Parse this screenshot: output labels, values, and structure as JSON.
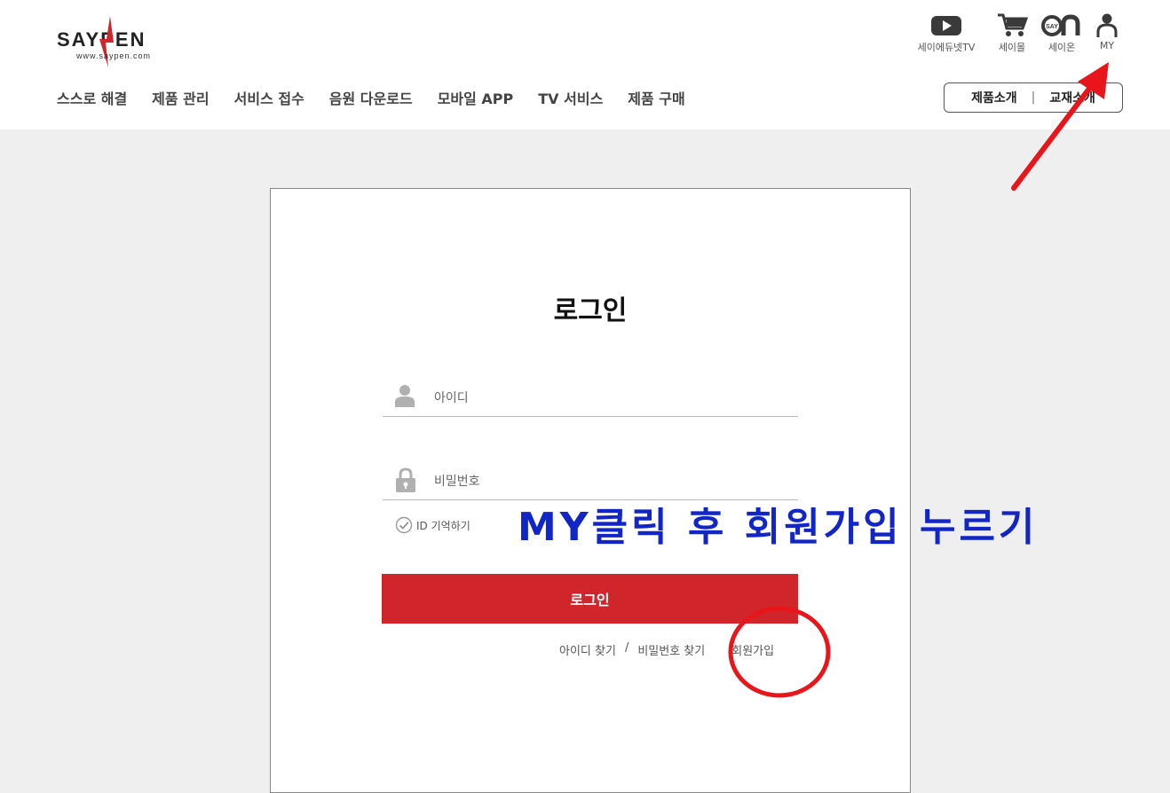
{
  "header": {
    "logo": {
      "text": "SAYPEN",
      "url": "www.saypen.com"
    },
    "nav": [
      "스스로 해결",
      "제품 관리",
      "서비스 접수",
      "음원 다운로드",
      "모바일 APP",
      "TV 서비스",
      "제품 구매"
    ],
    "utilities": [
      {
        "label": "세이에듀넷TV",
        "icon": "youtube-play-icon"
      },
      {
        "label": "세이몰",
        "icon": "shopping-cart-icon"
      },
      {
        "label": "세이온",
        "icon": "say-on-logo-icon"
      },
      {
        "label": "MY",
        "icon": "user-icon"
      }
    ],
    "intro_links": {
      "product": "제품소개",
      "separator": "|",
      "textbook": "교재소개"
    }
  },
  "login": {
    "title": "로그인",
    "id_placeholder": "아이디",
    "password_placeholder": "비밀번호",
    "remember_label": "ID 기억하기",
    "submit_label": "로그인",
    "find_id": "아이디 찾기",
    "separator": "/",
    "find_password": "비밀번호 찾기",
    "signup": "회원가입"
  },
  "annotation": {
    "instruction": "MY클릭 후 회원가입 누르기",
    "arrow_color": "#e8151b",
    "circle_color": "#e8151b",
    "text_color": "#1226c8"
  },
  "colors": {
    "accent": "#d0262b",
    "background": "#efefef"
  }
}
